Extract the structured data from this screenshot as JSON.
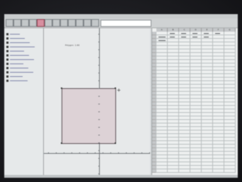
{
  "toolbar": {
    "tools": [
      "move-tool",
      "point-tool",
      "line-tool",
      "perpendicular-tool",
      "polygon-tool",
      "circle-tool",
      "angle-tool",
      "reflect-tool",
      "slider-tool",
      "zoom-tool",
      "undo-tool",
      "redo-tool"
    ],
    "active_tool": "polygon-tool"
  },
  "graphics": {
    "title": "Polygon: 1.60"
  },
  "colors": {
    "accent": "#d78fa0",
    "polygon_fill": "#ddd2d6"
  },
  "spreadsheet": {
    "columns": [
      "A",
      "B",
      "C",
      "D",
      "E",
      "F",
      "G"
    ],
    "row_count": 40
  }
}
